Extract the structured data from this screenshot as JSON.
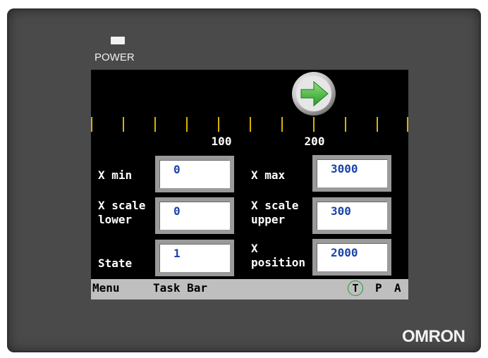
{
  "bezel": {
    "power_label": "POWER",
    "brand": "OMRON"
  },
  "screen": {
    "arrow_icon": "right-arrow-icon",
    "scale": {
      "labels": [
        "100",
        "200"
      ]
    },
    "fields": {
      "x_min": {
        "label": "X min",
        "value": "0"
      },
      "x_max": {
        "label": "X max",
        "value": "3000"
      },
      "x_scale_lower": {
        "label": "X scale\nlower",
        "value": "0"
      },
      "x_scale_upper": {
        "label": "X scale\nupper",
        "value": "300"
      },
      "state": {
        "label": "State",
        "value": "1"
      },
      "x_position": {
        "label": "X\nposition",
        "value": "2000"
      }
    },
    "taskbar": {
      "menu": "Menu",
      "task_bar": "Task Bar",
      "t": "T",
      "p": "P",
      "a": "A"
    }
  },
  "colors": {
    "bezel": "#4a4a4a",
    "screen": "#000000",
    "tick": "#d8b200",
    "value_text": "#1a44a8",
    "arrow": "#3cb83c",
    "taskbar": "#bfbfbf"
  }
}
